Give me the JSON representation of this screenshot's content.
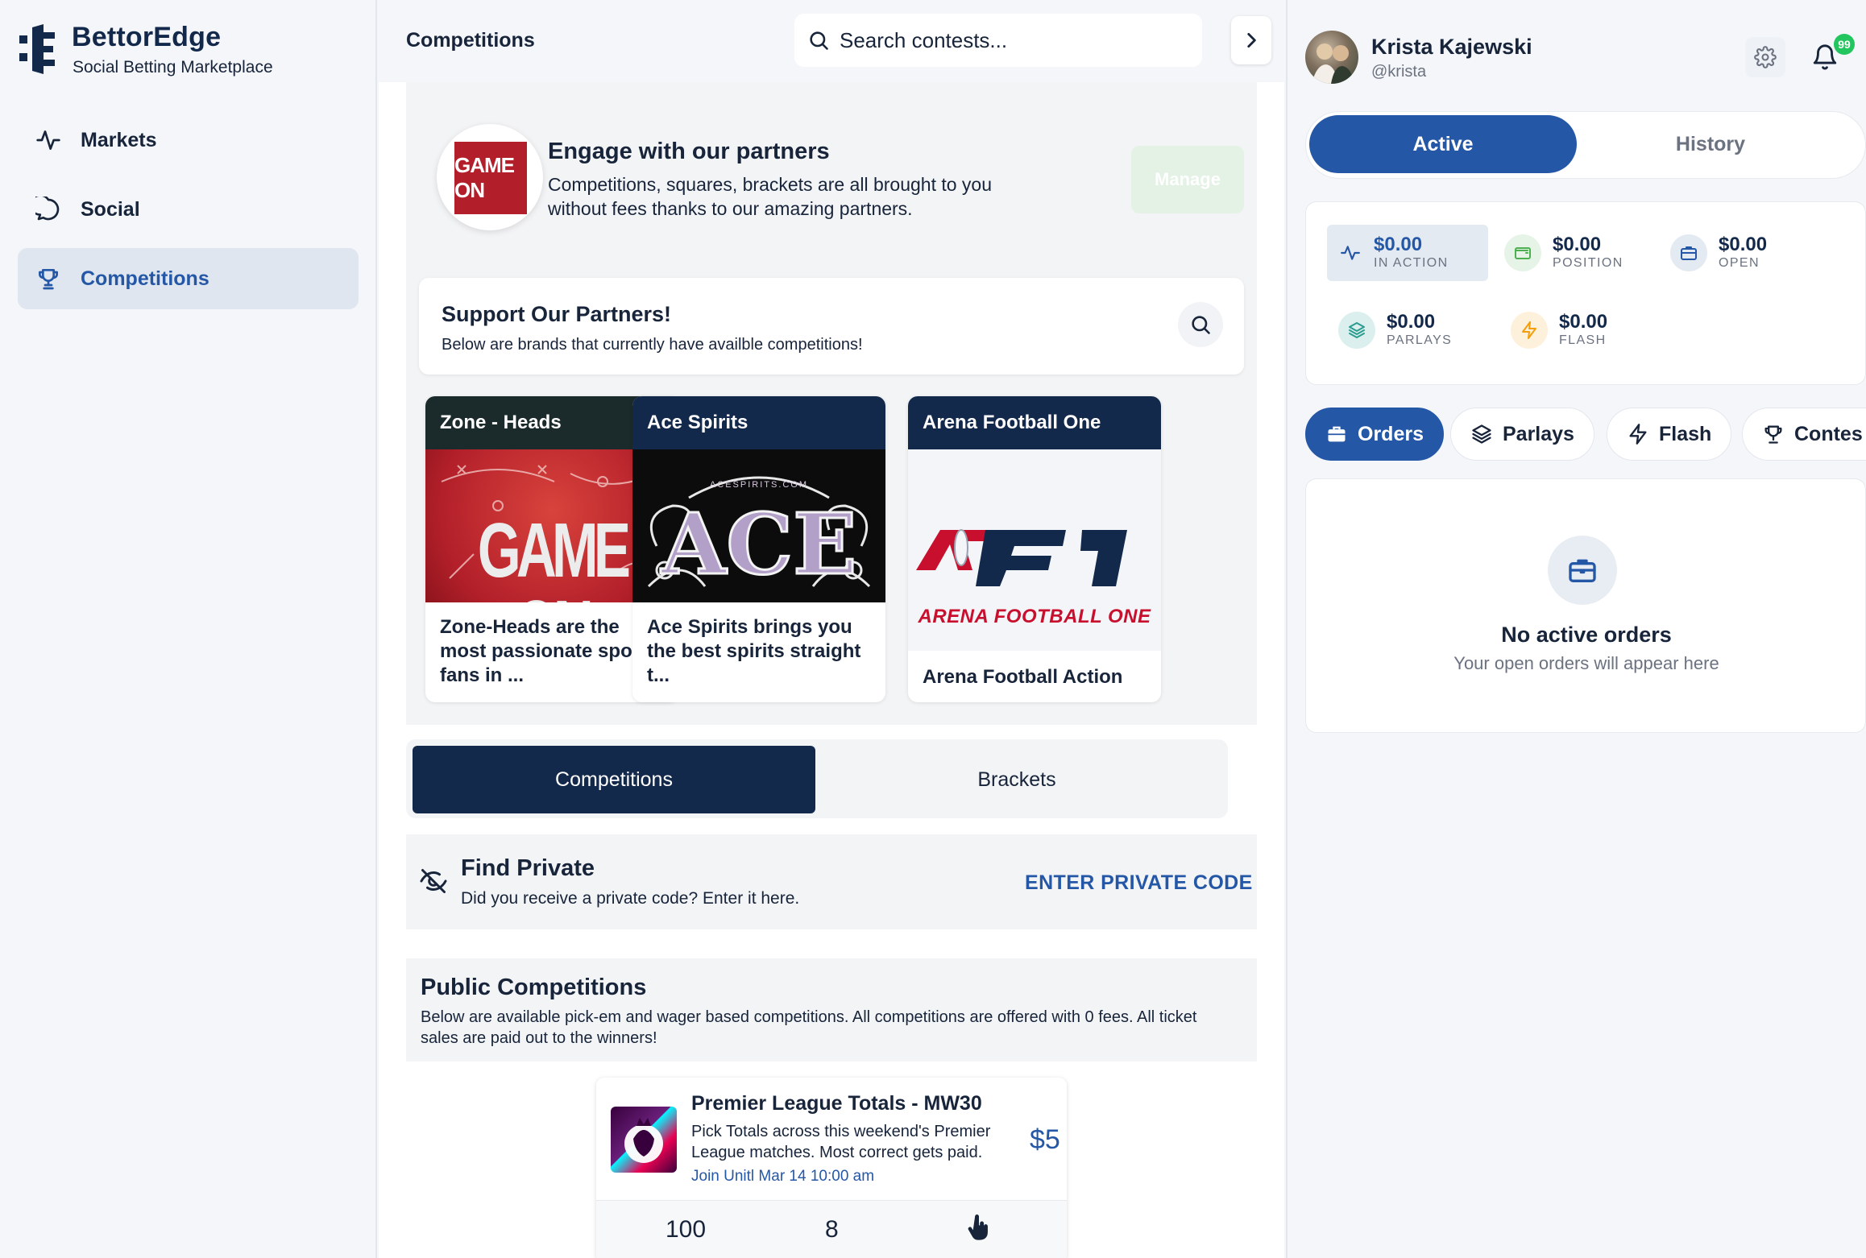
{
  "brand": {
    "name": "BettorEdge",
    "tagline": "Social Betting Marketplace"
  },
  "nav": {
    "items": [
      {
        "label": "Markets",
        "icon": "activity-icon"
      },
      {
        "label": "Social",
        "icon": "chat-bubble-icon"
      },
      {
        "label": "Competitions",
        "icon": "trophy-icon",
        "active": true
      }
    ]
  },
  "header": {
    "title": "Competitions",
    "search_placeholder": "Search contests..."
  },
  "partners": {
    "engage_title": "Engage with our partners",
    "engage_desc": "Competitions, squares, brackets are all brought to you without fees thanks to our amazing partners.",
    "manage_label": "Manage",
    "support_title": "Support Our Partners!",
    "support_desc": "Below are brands that currently have availble competitions!",
    "cards": [
      {
        "name": "Zone - Heads",
        "desc": "Zone-Heads are the most passionate sports fans in ...",
        "logo_text": "GAME ON",
        "header_color": "#1b2a2a"
      },
      {
        "name": "Ace Spirits",
        "desc": "Ace Spirits brings you the best spirits straight t...",
        "logo_text": "ACE",
        "logo_sub": "ACESPIRITS.COM",
        "header_color": "#13294b"
      },
      {
        "name": "Arena Football One",
        "desc": "Arena Football Action",
        "logo_text": "AF1",
        "logo_sub": "ARENA FOOTBALL ONE",
        "header_color": "#13294b"
      }
    ],
    "mini_logo_text": "GAME ON"
  },
  "segment": {
    "competitions": "Competitions",
    "brackets": "Brackets"
  },
  "private": {
    "title": "Find Private",
    "desc": "Did you receive a private code? Enter it here.",
    "link": "ENTER PRIVATE CODE"
  },
  "public": {
    "title": "Public Competitions",
    "desc": "Below are available pick-em and wager based competitions.  All competitions are offered with 0 fees. All ticket sales are paid out to the winners!"
  },
  "contest": {
    "title": "Premier League Totals - MW30",
    "desc": "Pick Totals across this weekend's Premier League matches. Most correct gets paid.",
    "join": "Join Unitl Mar 14 10:00 am",
    "price": "$5",
    "stat1": "100",
    "stat2": "8"
  },
  "user": {
    "name": "Krista Kajewski",
    "handle": "@krista",
    "notifications": "99"
  },
  "tabs": {
    "active": "Active",
    "history": "History"
  },
  "stats": [
    {
      "value": "$0.00",
      "label": "IN ACTION",
      "icon": "pulse-icon",
      "color": "#2557a7"
    },
    {
      "value": "$0.00",
      "label": "POSITION",
      "icon": "wallet-icon",
      "color": "#4caf50"
    },
    {
      "value": "$0.00",
      "label": "OPEN",
      "icon": "briefcase-icon",
      "color": "#2557a7"
    },
    {
      "value": "$0.00",
      "label": "PARLAYS",
      "icon": "layers-icon",
      "color": "#2a9d8f"
    },
    {
      "value": "$0.00",
      "label": "FLASH",
      "icon": "lightning-icon",
      "color": "#f59e0b"
    }
  ],
  "pills": {
    "orders": "Orders",
    "parlays": "Parlays",
    "flash": "Flash",
    "contests": "Contes"
  },
  "empty": {
    "title": "No active orders",
    "sub": "Your open orders will appear here"
  }
}
